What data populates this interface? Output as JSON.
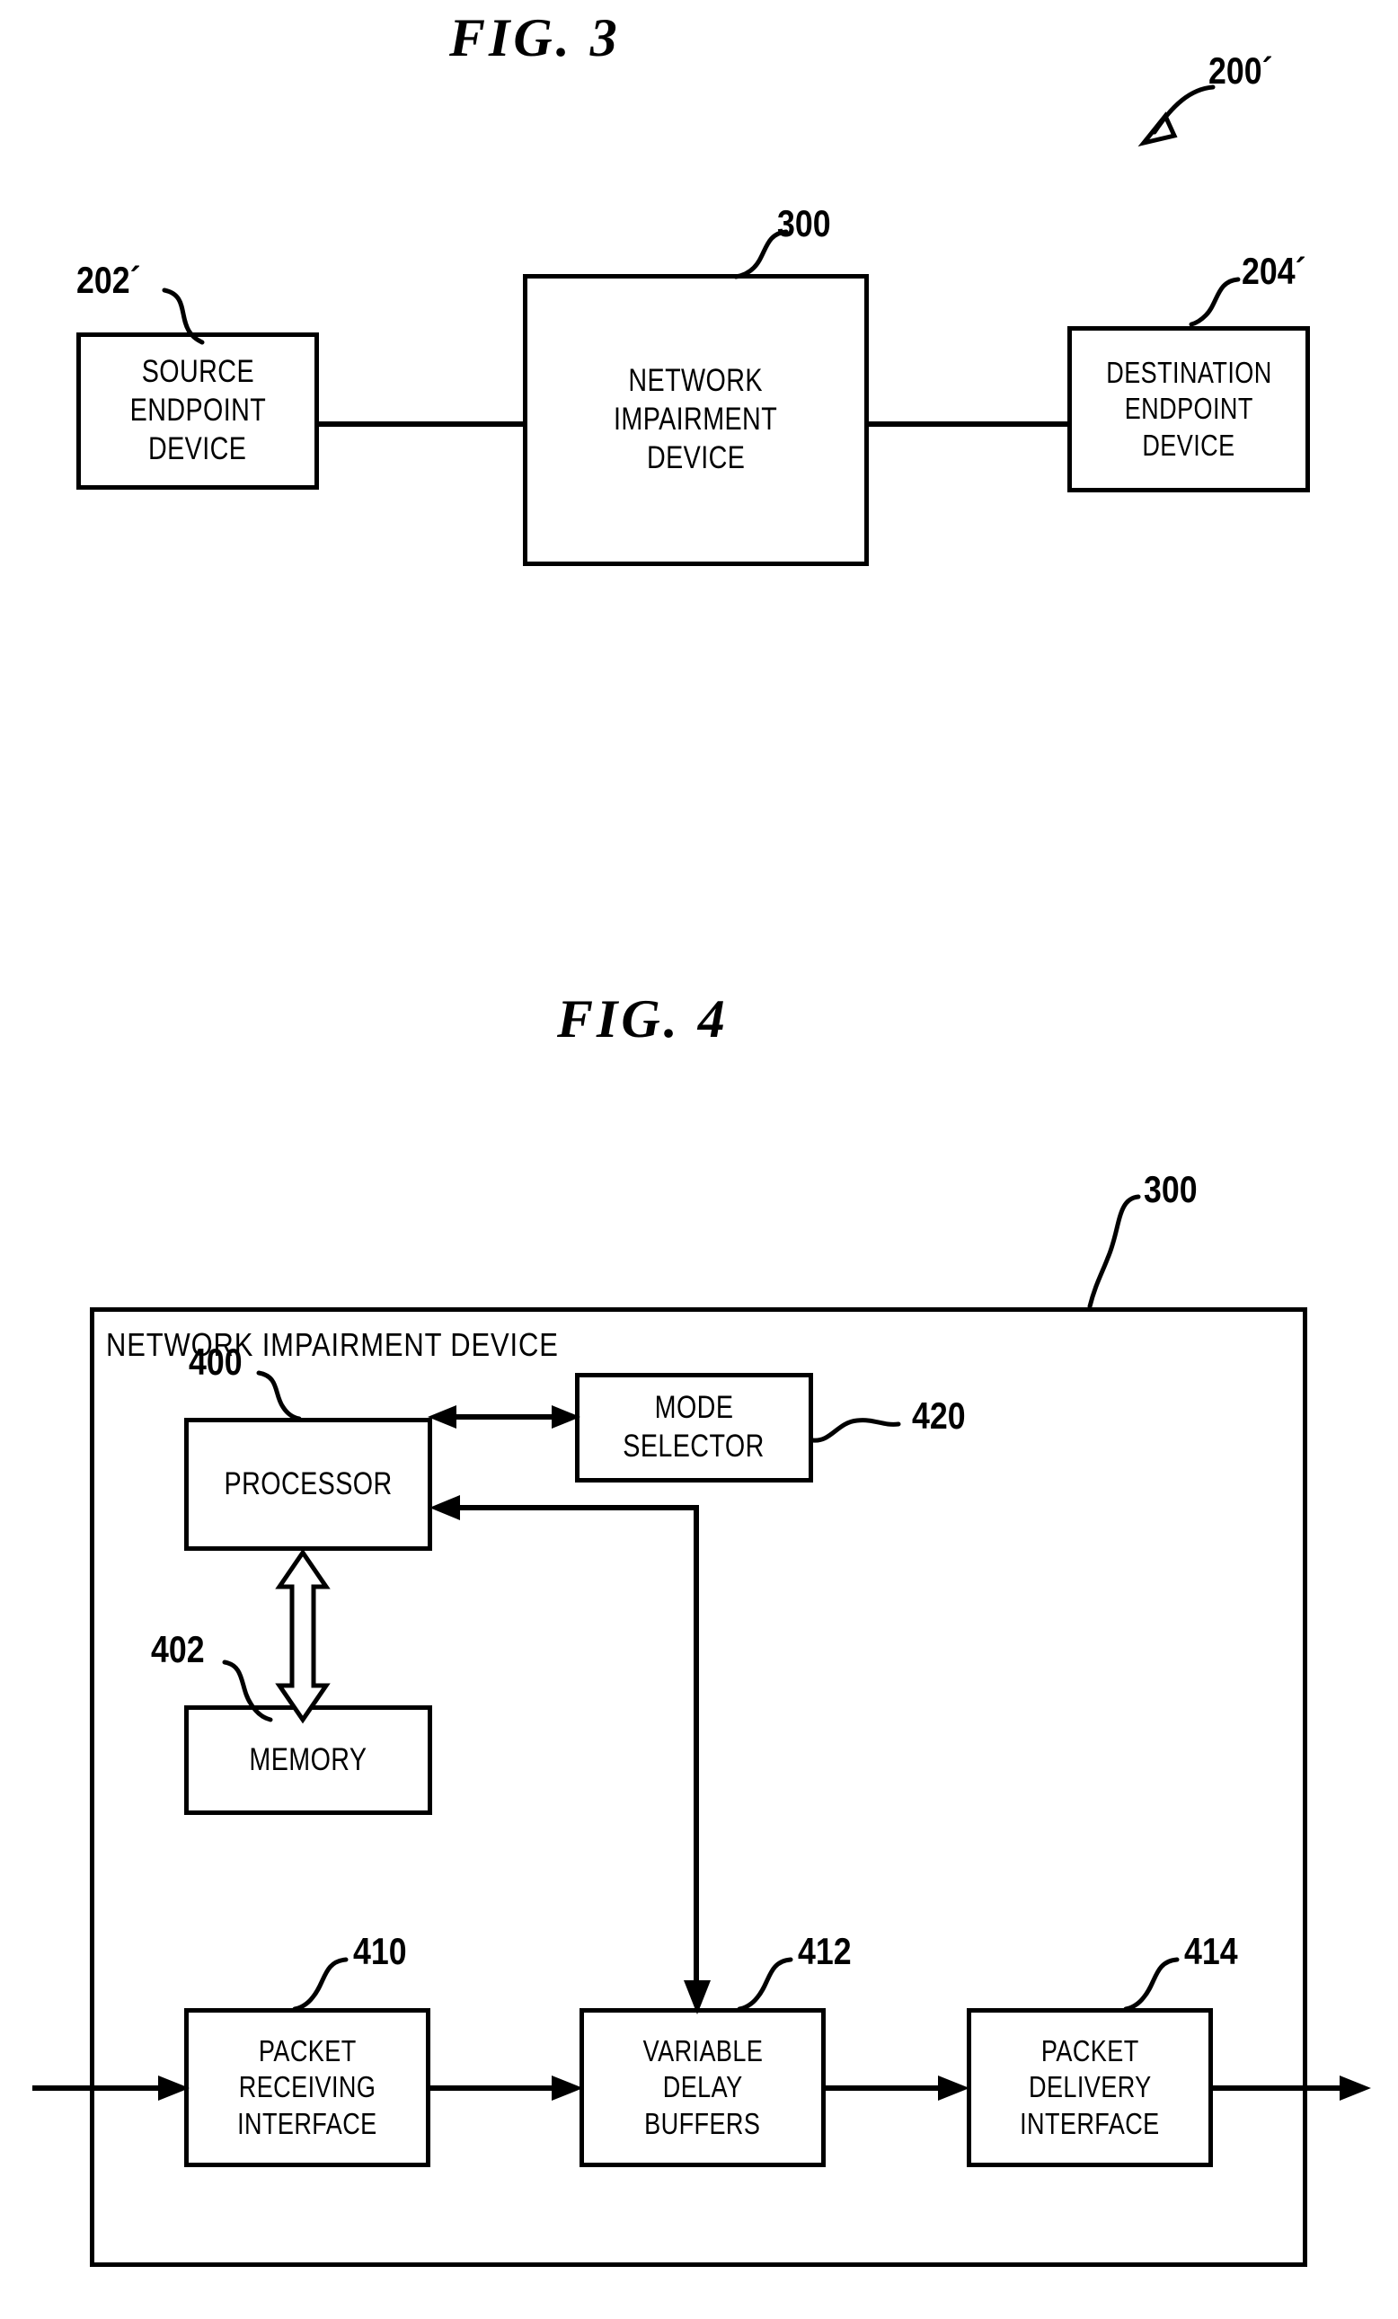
{
  "figures": [
    {
      "id": "fig3",
      "title": "FIG.  3",
      "system_ref": "200´",
      "blocks": [
        {
          "ref": "202´",
          "lines": [
            "SOURCE",
            "ENDPOINT",
            "DEVICE"
          ]
        },
        {
          "ref": "300",
          "lines": [
            "NETWORK",
            "IMPAIRMENT",
            "DEVICE"
          ]
        },
        {
          "ref": "204´",
          "lines": [
            "DESTINATION",
            "ENDPOINT",
            "DEVICE"
          ]
        }
      ]
    },
    {
      "id": "fig4",
      "title": "FIG.  4",
      "container": {
        "ref": "300",
        "label": "NETWORK  IMPAIRMENT  DEVICE"
      },
      "blocks": [
        {
          "ref": "400",
          "lines": [
            "PROCESSOR"
          ]
        },
        {
          "ref": "420",
          "lines": [
            "MODE",
            "SELECTOR"
          ]
        },
        {
          "ref": "402",
          "lines": [
            "MEMORY"
          ]
        },
        {
          "ref": "410",
          "lines": [
            "PACKET",
            "RECEIVING",
            "INTERFACE"
          ]
        },
        {
          "ref": "412",
          "lines": [
            "VARIABLE",
            "DELAY",
            "BUFFERS"
          ]
        },
        {
          "ref": "414",
          "lines": [
            "PACKET",
            "DELIVERY",
            "INTERFACE"
          ]
        }
      ]
    }
  ],
  "colors": {
    "ink": "#000000",
    "paper": "#ffffff"
  }
}
